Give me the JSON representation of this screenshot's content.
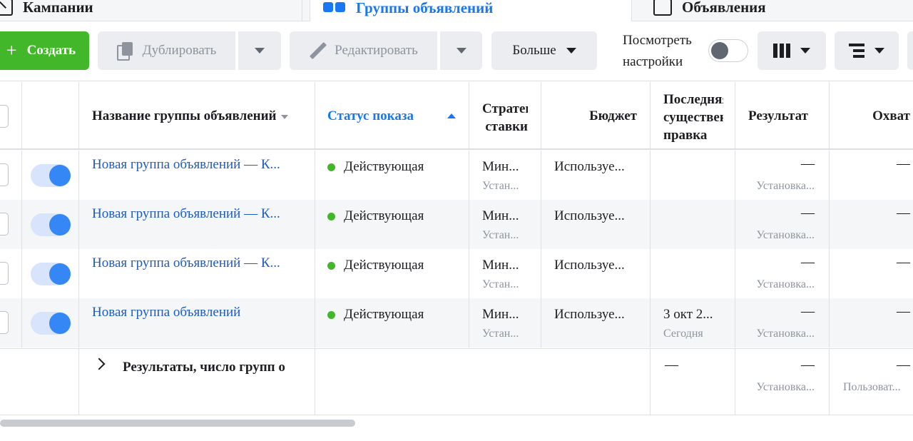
{
  "tabs": {
    "campaigns": "Кампании",
    "adsets": "Группы объявлений",
    "ads": "Объявления"
  },
  "toolbar": {
    "create": "Создать",
    "duplicate": "Дублировать",
    "edit": "Редактировать",
    "more": "Больше",
    "view_settings_line1": "Посмотреть",
    "view_settings_line2": "настройки",
    "view_settings_toggle": "off"
  },
  "columns": {
    "name": "Название группы объявлений",
    "status": "Статус показа",
    "strategy_line1": "Стратегия",
    "strategy_line2": "ставки",
    "budget": "Бюджет",
    "last_edit_line1": "Последняя",
    "last_edit_line2": "существенная",
    "last_edit_line3": "правка",
    "result": "Результат",
    "reach": "Охват"
  },
  "rows": [
    {
      "name": "Новая группа объявлений — К...",
      "status": "Действующая",
      "strategy": "Мин...",
      "strategy_sub": "Устан...",
      "budget": "Используе...",
      "last_edit": "",
      "last_edit_sub": "",
      "result": "—",
      "result_sub": "Установка...",
      "reach": "—"
    },
    {
      "name": "Новая группа объявлений — К...",
      "status": "Действующая",
      "strategy": "Мин...",
      "strategy_sub": "Устан...",
      "budget": "Используе...",
      "last_edit": "",
      "last_edit_sub": "",
      "result": "—",
      "result_sub": "Установка...",
      "reach": "—"
    },
    {
      "name": "Новая группа объявлений — К...",
      "status": "Действующая",
      "strategy": "Мин...",
      "strategy_sub": "Устан...",
      "budget": "Используе...",
      "last_edit": "",
      "last_edit_sub": "",
      "result": "—",
      "result_sub": "Установка...",
      "reach": "—"
    },
    {
      "name": "Новая группа объявлений",
      "status": "Действующая",
      "strategy": "Мин...",
      "strategy_sub": "Устан...",
      "budget": "Используе...",
      "last_edit": "3 окт 2...",
      "last_edit_sub": "Сегодня",
      "result": "—",
      "result_sub": "Установка...",
      "reach": "—"
    }
  ],
  "totals": {
    "label": "Результаты, число групп о",
    "last_edit": "—",
    "result": "—",
    "result_sub": "Установка...",
    "reach": "—",
    "reach_sub": "Пользоват..."
  },
  "colors": {
    "accent": "#1877f2",
    "create_button": "#42b72a",
    "status_active": "#42b72a"
  }
}
